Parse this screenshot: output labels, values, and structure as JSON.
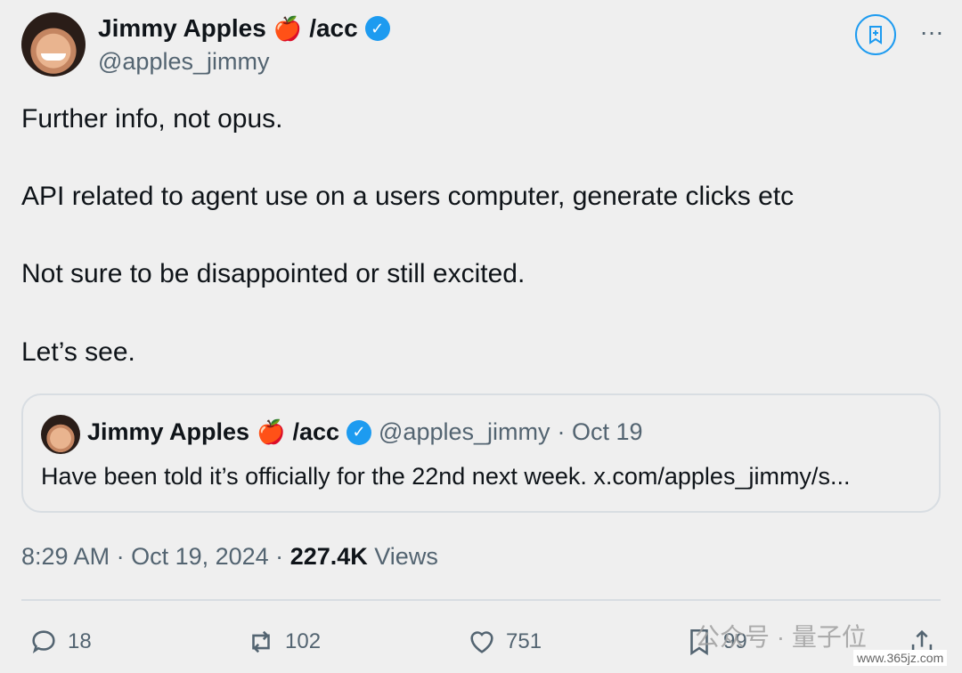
{
  "tweet": {
    "author_name": "Jimmy Apples",
    "author_suffix": "/acc",
    "handle": "@apples_jimmy",
    "paragraphs": [
      "Further info, not opus.",
      "API related to agent use on a users computer, generate clicks etc",
      "Not sure to be disappointed or still excited.",
      "Let’s see."
    ],
    "quoted": {
      "author_name": "Jimmy Apples",
      "author_suffix": "/acc",
      "handle": "@apples_jimmy",
      "date": "· Oct 19",
      "text": "Have been told it’s officially for the 22nd next week. x.com/apples_jimmy/s..."
    },
    "time": "8:29 AM",
    "date": "· Oct 19, 2024 ·",
    "views_count": "227.4K",
    "views_label": "Views"
  },
  "actions": {
    "replies": "18",
    "retweets": "102",
    "likes": "751",
    "bookmarks": "99"
  },
  "icons": {
    "apple": "🍎",
    "verified": "✓",
    "more": "…"
  },
  "watermark": {
    "main": "公众号 · 量子位",
    "site": "www.365jz.com"
  },
  "colors": {
    "accent": "#1d9bf0",
    "text": "#0f1419",
    "muted": "#536471"
  }
}
